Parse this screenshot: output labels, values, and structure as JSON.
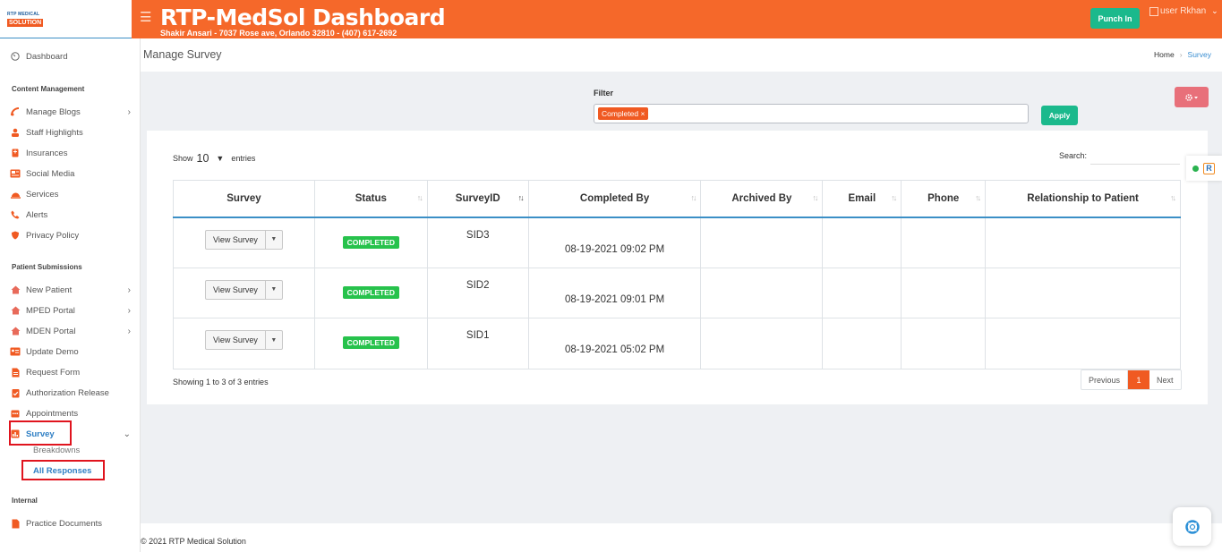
{
  "brand": {
    "logo_top": "RTP MEDICAL",
    "logo_bottom": "SOLUTION"
  },
  "header": {
    "title": "RTP-MedSol Dashboard",
    "subtitle": "Shakir Ansari - 7037 Rose ave, Orlando 32810 - (407) 617-2692",
    "punch_label": "Punch In",
    "user_label": "user Rkhan"
  },
  "sidebar": {
    "dashboard": "Dashboard",
    "sections": [
      {
        "title": "Content Management",
        "items": [
          "Manage Blogs",
          "Staff Highlights",
          "Insurances",
          "Social Media",
          "Services",
          "Alerts",
          "Privacy Policy"
        ]
      },
      {
        "title": "Patient Submissions",
        "items": [
          "New Patient",
          "MPED Portal",
          "MDEN Portal",
          "Update Demo",
          "Request Form",
          "Authorization Release",
          "Appointments",
          "Survey"
        ]
      },
      {
        "title": "Internal",
        "items": [
          "Practice Documents"
        ]
      }
    ],
    "survey_sub": [
      "Breakdowns",
      "All Responses"
    ]
  },
  "page": {
    "title": "Manage Survey",
    "breadcrumb": [
      "Home",
      "Survey"
    ]
  },
  "filter": {
    "label": "Filter",
    "chip": "Completed ×",
    "apply_label": "Apply"
  },
  "table": {
    "show_prefix": "Show",
    "show_value": "10",
    "show_suffix": "entries",
    "search_label": "Search:",
    "columns": [
      "Survey",
      "Status",
      "SurveyID",
      "Completed By",
      "Archived By",
      "Email",
      "Phone",
      "Relationship to Patient"
    ],
    "view_label": "View Survey",
    "rows": [
      {
        "status": "COMPLETED",
        "id": "SID3",
        "completed_by": "08-19-2021 09:02 PM"
      },
      {
        "status": "COMPLETED",
        "id": "SID2",
        "completed_by": "08-19-2021 09:01 PM"
      },
      {
        "status": "COMPLETED",
        "id": "SID1",
        "completed_by": "08-19-2021 05:02 PM"
      }
    ],
    "info": "Showing 1 to 3 of 3 entries",
    "pager": {
      "prev": "Previous",
      "page": "1",
      "next": "Next"
    }
  },
  "footer": "© 2021 RTP Medical Solution",
  "colors": {
    "accent": "#f5682a",
    "success": "#1bb98c",
    "badge": "#27c24c",
    "link": "#3a8ed1"
  }
}
